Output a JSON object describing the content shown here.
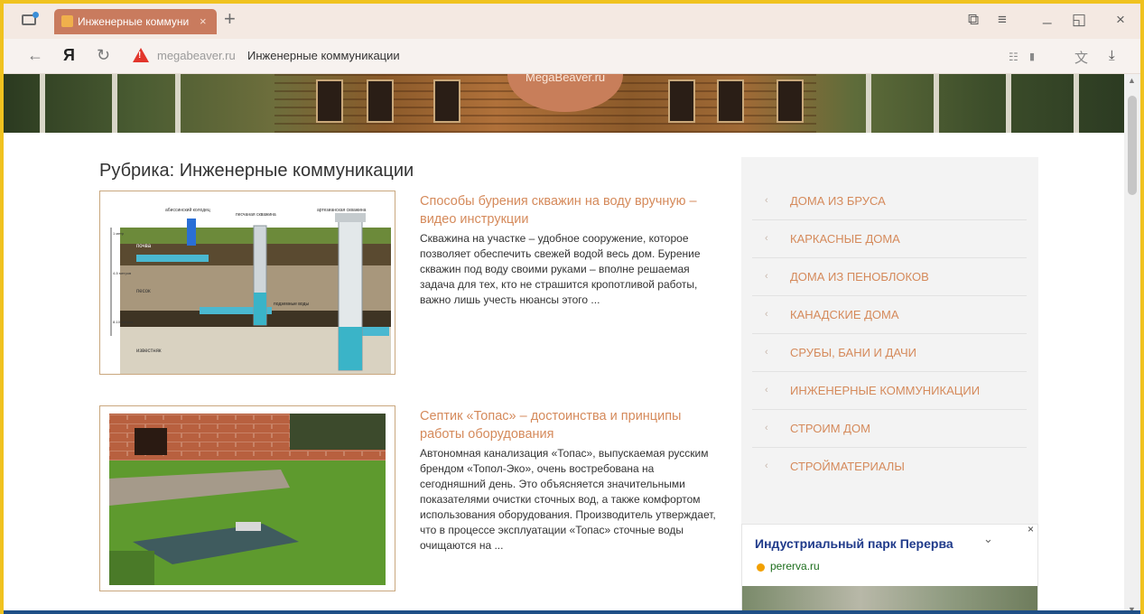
{
  "browser": {
    "tab": {
      "title": "Инженерные коммуни",
      "close": "×"
    },
    "new_tab": "+",
    "window_controls": {
      "tabs": "⧉",
      "menu": "≡",
      "minimize": "_",
      "restore": "◱",
      "close": "×"
    },
    "nav": {
      "back": "←",
      "yandex": "Я",
      "reload": "↻"
    },
    "address": {
      "warning": "!",
      "domain": "megabeaver.ru",
      "page_title": "Инженерные коммуникации"
    },
    "addr_right": {
      "reader": "☷",
      "bookmark": "▮",
      "translate": "文",
      "download": "⤓"
    }
  },
  "banner": {
    "logo": "MegaBeaver.ru"
  },
  "page": {
    "rubric": "Рубрика: Инженерные коммуникации",
    "posts": [
      {
        "title": "Способы бурения скважин на воду вручную – видео инструкции",
        "excerpt": "Скважина на участке – удобное сооружение, которое позволяет обеспечить свежей водой весь дом. Бурение скважин под воду своими руками – вполне решаемая задача для тех, кто не страшится кропотливой работы, важно лишь учесть нюансы этого ...",
        "image_labels": {
          "col1": "абиссинский колодец",
          "col2": "песчаная скважина",
          "col3": "артезианская скважина",
          "layer1": "почва",
          "layer2": "песок",
          "layer3": "известняк",
          "water": "подземные воды",
          "depth1": "1 метр",
          "depth2": "4-5 метров",
          "depth3": "8-10 метров"
        }
      },
      {
        "title": "Септик «Топас» – достоинства и принципы работы оборудования",
        "excerpt": "Автономная канализация «Топас», выпускаемая русским брендом «Топол-Эко», очень востребована на сегодняшний день. Это объясняется значительными показателями очистки сточных вод, а также комфортом использования оборудования. Производитель утверждает, что в процессе эксплуатации «Топас» сточные воды очищаются на ..."
      }
    ]
  },
  "sidebar": {
    "chevron": "‹",
    "items": [
      "ДОМА ИЗ БРУСА",
      "КАРКАСНЫЕ ДОМА",
      "ДОМА ИЗ ПЕНОБЛОКОВ",
      "КАНАДСКИЕ ДОМА",
      "СРУБЫ, БАНИ И ДАЧИ",
      "ИНЖЕНЕРНЫЕ КОММУНИКАЦИИ",
      "СТРОИМ ДОМ",
      "СТРОЙМАТЕРИАЛЫ"
    ]
  },
  "ad": {
    "title": "Индустриальный парк Перерва",
    "chevron": "⌄",
    "close": "×",
    "url": "pererva.ru"
  },
  "colors": {
    "accent": "#d58a5b",
    "tab": "#c97b5e",
    "frame": "#f0c21f",
    "ad_title": "#1f3a8a",
    "ad_url": "#1e6e1e"
  }
}
